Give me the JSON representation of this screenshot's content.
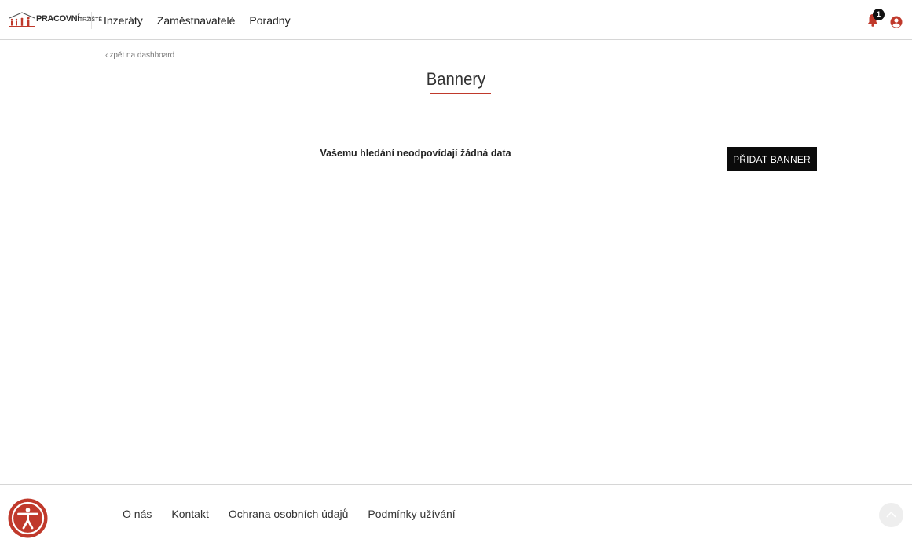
{
  "header": {
    "logo_text": "PRACOVNÍ",
    "logo_small": "TRŽIŠTĚ",
    "nav": [
      "Inzeráty",
      "Zaměstnavatelé",
      "Poradny"
    ],
    "notification_count": "1",
    "icons": [
      "bell-icon",
      "user-icon"
    ]
  },
  "content": {
    "back_link": "zpět na dashboard",
    "title": "Bannery",
    "empty_message": "Vašemu hledání neodpovídají žádná data",
    "add_button": "PŘIDAT BANNER"
  },
  "footer": {
    "links": [
      "O nás",
      "Kontakt",
      "Ochrana osobních údajů",
      "Podmínky užívání"
    ],
    "icons": [
      "accessibility-icon",
      "chevron-up-icon"
    ]
  },
  "colors": {
    "accent": "#c0392b",
    "button_bg": "#0b0b0b",
    "border": "#d6d6d6"
  }
}
